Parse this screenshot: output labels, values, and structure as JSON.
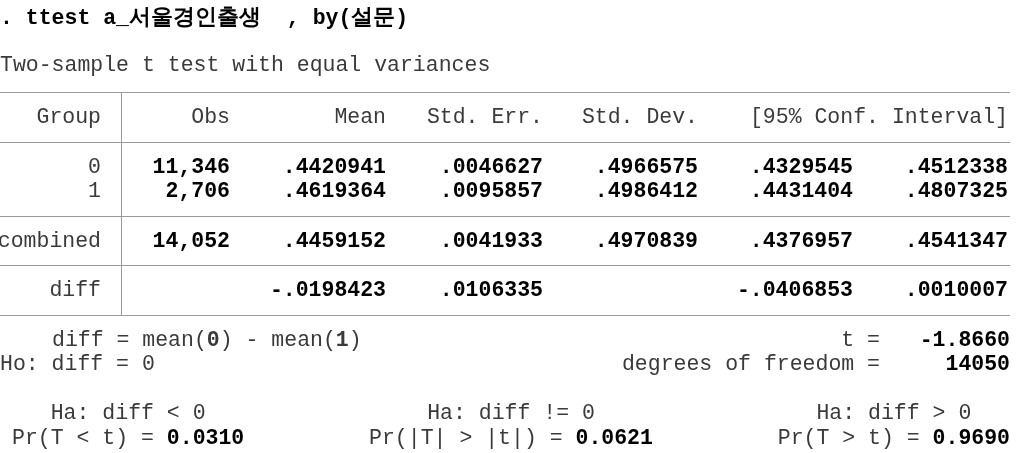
{
  "command": ". ttest a_서울경인출생  , by(설문)",
  "subtitle": "Two-sample t test with equal variances",
  "table": {
    "columns": [
      "Group",
      "Obs",
      "Mean",
      "Std. Err.",
      "Std. Dev.",
      "[95% Conf. Interval]"
    ],
    "sections": [
      [
        {
          "group": "0",
          "cells": [
            "11,346",
            ".4420941",
            ".0046627",
            ".4966575",
            ".4329545",
            ".4512338"
          ]
        },
        {
          "group": "1",
          "cells": [
            "2,706",
            ".4619364",
            ".0095857",
            ".4986412",
            ".4431404",
            ".4807325"
          ]
        }
      ],
      [
        {
          "group": "combined",
          "cells": [
            "14,052",
            ".4459152",
            ".0041933",
            ".4970839",
            ".4376957",
            ".4541347"
          ]
        }
      ],
      [
        {
          "group": "diff",
          "cells": [
            null,
            "-.0198423",
            ".0106335",
            null,
            "-.0406853",
            ".0010007"
          ]
        }
      ]
    ]
  },
  "summary": [
    {
      "left": "diff = mean(**0**) - mean(**1**)",
      "left_indent": true,
      "right_label": "t =",
      "right_value": "-1.8660"
    },
    {
      "left": "Ho: diff = 0",
      "left_indent": false,
      "right_label": "degrees of freedom =",
      "right_value": "14050"
    }
  ],
  "alternatives": [
    {
      "hypothesis": "Ha: diff < 0",
      "p_label": "Pr(T < t) =",
      "p_value": "0.0310"
    },
    {
      "hypothesis": "Ha: diff != 0",
      "p_label": "Pr(|T| > |t|) =",
      "p_value": "0.0621"
    },
    {
      "hypothesis": "Ha: diff > 0",
      "p_label": "Pr(T > t) =",
      "p_value": "0.9690"
    }
  ]
}
